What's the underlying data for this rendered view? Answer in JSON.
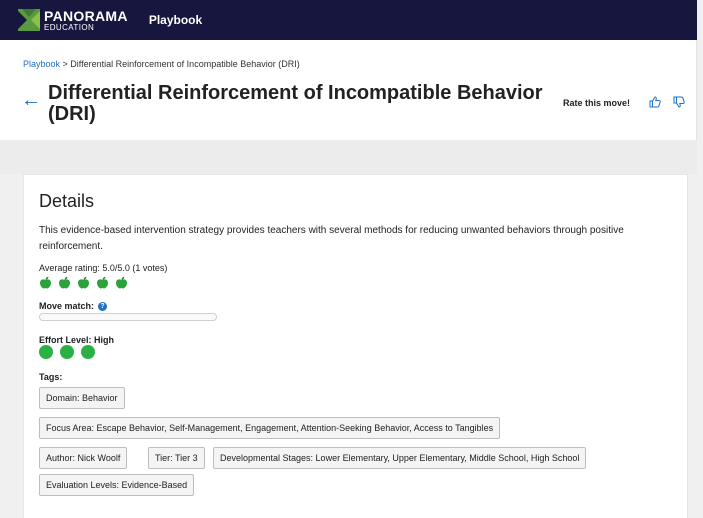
{
  "navbar": {
    "logo_line1": "PANORAMA",
    "logo_line2": "EDUCATION",
    "link": "Playbook"
  },
  "breadcrumb": {
    "root": "Playbook",
    "separator": " > ",
    "current": "Differential Reinforcement of Incompatible Behavior (DRI)"
  },
  "header": {
    "title": "Differential Reinforcement of Incompatible Behavior (DRI)",
    "rate_label": "Rate this move!",
    "rate_icons": [
      "thumbs-up-icon",
      "thumbs-down-icon"
    ]
  },
  "details": {
    "heading": "Details",
    "description": "This evidence-based intervention strategy provides teachers with several methods for reducing unwanted behaviors through positive reinforcement.",
    "rating_label": "Average rating: 5.0/5.0 (1 votes)",
    "rating_value": 5,
    "rating_max": 5,
    "move_match_label": "Move match:",
    "move_match_fraction": 0,
    "effort_label": "Effort Level: High",
    "effort_dots": 3,
    "tags_label": "Tags:",
    "tags": [
      "Domain: Behavior",
      "Focus Area: Escape Behavior, Self-Management, Engagement, Attention-Seeking Behavior, Access to Tangibles",
      "Author: Nick Woolf",
      "Tier: Tier 3",
      "Developmental Stages: Lower Elementary, Upper Elementary, Middle School, High School",
      "Evaluation Levels: Evidence-Based"
    ]
  },
  "colors": {
    "navbar": "#16163f",
    "link": "#1f6fc5",
    "apple": "#2ba33a",
    "effort_dot": "#2bb043"
  }
}
